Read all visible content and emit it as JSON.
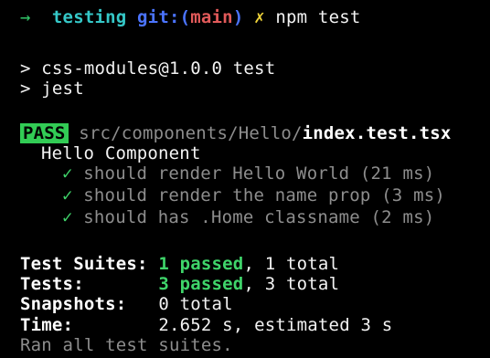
{
  "prompt": {
    "arrow": "→",
    "directory": "testing",
    "git_label": "git:",
    "paren_open": "(",
    "branch": "main",
    "paren_close": ")",
    "dirty_marker": "✗",
    "command": "npm test"
  },
  "npm": {
    "line1": "> css-modules@1.0.0 test",
    "line2": "> jest"
  },
  "result": {
    "badge": "PASS",
    "path_dir": "src/components/Hello/",
    "path_file": "index.test.tsx"
  },
  "suite": {
    "name": "Hello Component",
    "tests": [
      {
        "check": "✓",
        "text": "should render Hello World (21 ms)"
      },
      {
        "check": "✓",
        "text": "should render the name prop (3 ms)"
      },
      {
        "check": "✓",
        "text": "should has .Home classname (2 ms)"
      }
    ]
  },
  "summary": {
    "suites_label": "Test Suites:",
    "suites_passed": "1 passed",
    "suites_total": ", 1 total",
    "tests_label": "Tests:",
    "tests_passed": "3 passed",
    "tests_total": ", 3 total",
    "snapshots_label": "Snapshots:",
    "snapshots_value": "0 total",
    "time_label": "Time:",
    "time_value": "2.652 s, estimated 3 s",
    "footer": "Ran all test suites."
  },
  "colors": {
    "background": "#000000",
    "pass_badge": "#32cc55",
    "green": "#3fd46a",
    "cyan": "#35c8c8",
    "blue": "#4b74ff",
    "red": "#e25a5a",
    "yellow": "#f0d43a",
    "dim": "#8d8d8d"
  }
}
